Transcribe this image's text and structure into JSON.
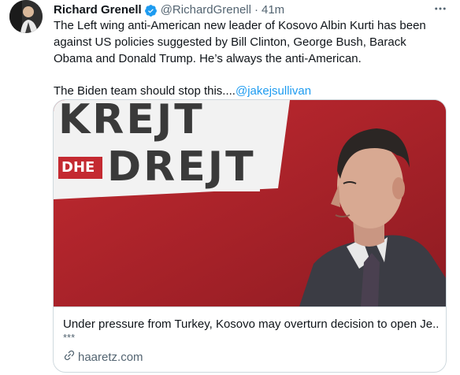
{
  "tweet": {
    "author_name": "Richard Grenell",
    "handle": "@RichardGrenell",
    "separator": "·",
    "time": "41m",
    "text_line1": "The Left wing anti-American new leader of Kosovo Albin Kurti has been against US policies suggested by Bill Clinton, George Bush, Barack Obama and Donald Trump. He’s always the anti-American.",
    "text_line2_prefix": "The Biden team should stop this....",
    "mention": "@jakejsullivan"
  },
  "card": {
    "image_text_top": "KREJT",
    "image_text_small": "DHE",
    "image_text_bottom": "DREJT",
    "title": "Under pressure from Turkey, Kosovo may overturn decision to open Je...",
    "description": "***",
    "domain": "haaretz.com"
  },
  "icons": {
    "verified": "verified-badge-icon",
    "more": "more-icon",
    "link": "link-icon"
  },
  "colors": {
    "accent": "#1d9bf0",
    "secondary_text": "#536471",
    "banner_red": "#b8242c"
  }
}
